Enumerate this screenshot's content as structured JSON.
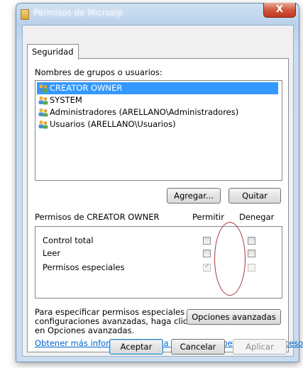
{
  "window": {
    "title": "Permisos de Microsip",
    "close_label": "X"
  },
  "tabs": [
    {
      "label": "Seguridad"
    }
  ],
  "groups": {
    "label": "Nombres de grupos o usuarios:",
    "items": [
      {
        "name": "CREATOR OWNER",
        "selected": true
      },
      {
        "name": "SYSTEM",
        "selected": false
      },
      {
        "name": "Administradores (ARELLANO\\Administradores)",
        "selected": false
      },
      {
        "name": "Usuarios (ARELLANO\\Usuarios)",
        "selected": false
      }
    ]
  },
  "buttons": {
    "add": "Agregar...",
    "remove": "Quitar",
    "advanced": "Opciones avanzadas",
    "ok": "Aceptar",
    "cancel": "Cancelar",
    "apply": "Aplicar"
  },
  "permissions": {
    "title": "Permisos de CREATOR OWNER",
    "allow_header": "Permitir",
    "deny_header": "Denegar",
    "rows": [
      {
        "label": "Control total",
        "allow": false,
        "deny": false
      },
      {
        "label": "Leer",
        "allow": false,
        "deny": false
      },
      {
        "label": "Permisos especiales",
        "allow": true,
        "deny": false
      }
    ]
  },
  "special_note": {
    "lines": [
      "Para especificar permisos especiales o",
      "configuraciones avanzadas, haga clic",
      "en Opciones avanzadas."
    ]
  },
  "link_text": "Obtener más información acerca de control y permisos de acceso",
  "colors": {
    "selection": "#3399ff",
    "link": "#0066cc",
    "annotation": "#a63535"
  }
}
